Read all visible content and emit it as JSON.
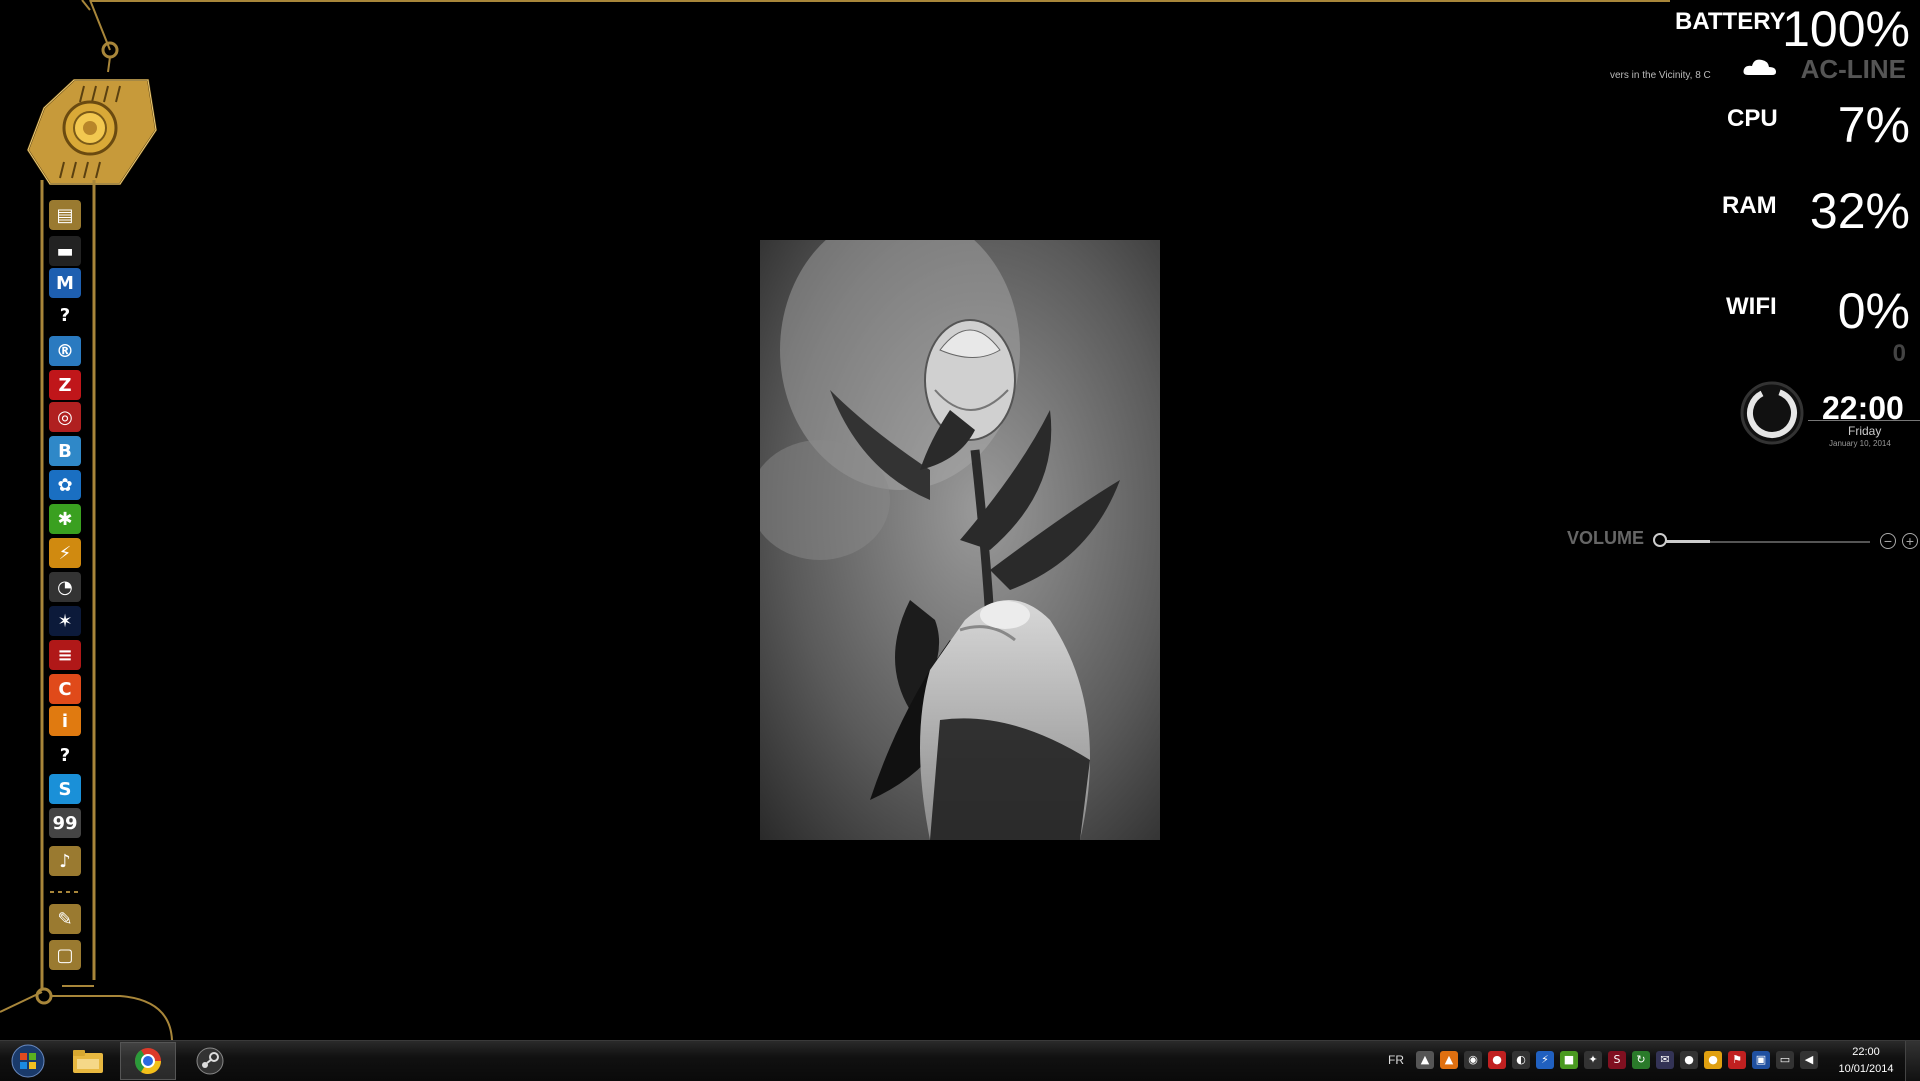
{
  "system": {
    "battery_label": "BATTERY",
    "battery_value": "100%",
    "weather_text": "vers in the Vicinity,  8 C",
    "power_source": "AC-LINE",
    "cpu_label": "CPU",
    "cpu_value": "7%",
    "ram_label": "RAM",
    "ram_value": "32%",
    "wifi_label": "WIFI",
    "wifi_value": "0%",
    "wifi_sub": "0"
  },
  "clock": {
    "time": "22:00",
    "day": "Friday",
    "date": "January 10, 2014"
  },
  "volume": {
    "label": "VOLUME",
    "level": 0.23,
    "minus": "−",
    "plus": "+"
  },
  "dock": {
    "items": [
      {
        "name": "folder-icon",
        "glyph": "▤",
        "color": "#9a7a30"
      },
      {
        "name": "window-icon",
        "glyph": "▬",
        "color": "#222"
      },
      {
        "name": "malwarebytes-icon",
        "glyph": "M",
        "color": "#1e5fb0"
      },
      {
        "name": "help-icon",
        "glyph": "?",
        "color": "#000"
      },
      {
        "name": "disc-icon",
        "glyph": "®",
        "color": "#2a7ac0"
      },
      {
        "name": "filezilla-icon",
        "glyph": "Z",
        "color": "#c0161a"
      },
      {
        "name": "live-icon",
        "glyph": "◎",
        "color": "#b02020"
      },
      {
        "name": "bads-icon",
        "glyph": "B",
        "color": "#2f88c8"
      },
      {
        "name": "film-reel-icon",
        "glyph": "✿",
        "color": "#1a6fc2"
      },
      {
        "name": "spider-icon",
        "glyph": "✱",
        "color": "#3aa020"
      },
      {
        "name": "lightning-icon",
        "glyph": "⚡",
        "color": "#d08a10"
      },
      {
        "name": "msi-gauge-icon",
        "glyph": "◔",
        "color": "#333"
      },
      {
        "name": "spider-dark-icon",
        "glyph": "✶",
        "color": "#0c1a3a"
      },
      {
        "name": "stripes-icon",
        "glyph": "≡",
        "color": "#b01818"
      },
      {
        "name": "ccleaner-icon",
        "glyph": "C",
        "color": "#e04a1a"
      },
      {
        "name": "info-icon",
        "glyph": "i",
        "color": "#e07a10"
      },
      {
        "name": "help-icon-2",
        "glyph": "?",
        "color": "#000"
      },
      {
        "name": "skype-icon",
        "glyph": "S",
        "color": "#1a90d8"
      },
      {
        "name": "99-icon",
        "glyph": "99",
        "color": "#444"
      },
      {
        "name": "mp3-icon",
        "glyph": "♪",
        "color": "#9a7a30"
      },
      {
        "name": "tools-icon",
        "glyph": "✎",
        "color": "#9a7a30"
      },
      {
        "name": "trash-icon",
        "glyph": "▢",
        "color": "#9a7a30"
      }
    ]
  },
  "taskbar": {
    "language": "FR",
    "time": "22:00",
    "date": "10/01/2014",
    "apps": [
      {
        "name": "start-orb-icon"
      },
      {
        "name": "explorer-icon"
      },
      {
        "name": "chrome-icon",
        "active": true
      },
      {
        "name": "steam-icon"
      }
    ],
    "tray": [
      {
        "name": "notification-icon",
        "glyph": "▲",
        "color": "#555"
      },
      {
        "name": "vlc-icon",
        "glyph": "▲",
        "color": "#e07010"
      },
      {
        "name": "steam-tray-icon",
        "glyph": "◉",
        "color": "#333"
      },
      {
        "name": "antivirus-icon",
        "glyph": "●",
        "color": "#c02020"
      },
      {
        "name": "ccleaner-tray-icon",
        "glyph": "◐",
        "color": "#333"
      },
      {
        "name": "lightning-tray-icon",
        "glyph": "⚡",
        "color": "#2060c0"
      },
      {
        "name": "nvidia-icon",
        "glyph": "■",
        "color": "#4a9a20"
      },
      {
        "name": "network-tray-icon",
        "glyph": "✦",
        "color": "#333"
      },
      {
        "name": "s2-icon",
        "glyph": "S",
        "color": "#801020"
      },
      {
        "name": "refresh-tray-icon",
        "glyph": "↻",
        "color": "#2a7a2a"
      },
      {
        "name": "mail-icon",
        "glyph": "✉",
        "color": "#335"
      },
      {
        "name": "drop-icon",
        "glyph": "●",
        "color": "#333"
      },
      {
        "name": "orange-icon",
        "glyph": "●",
        "color": "#e0a010"
      },
      {
        "name": "flag-icon",
        "glyph": "⚑",
        "color": "#c02020"
      },
      {
        "name": "monitor-icon",
        "glyph": "▣",
        "color": "#2050a0"
      },
      {
        "name": "display-tray-icon",
        "glyph": "▭",
        "color": "#333"
      },
      {
        "name": "speaker-icon",
        "glyph": "◀",
        "color": "#333"
      }
    ]
  }
}
